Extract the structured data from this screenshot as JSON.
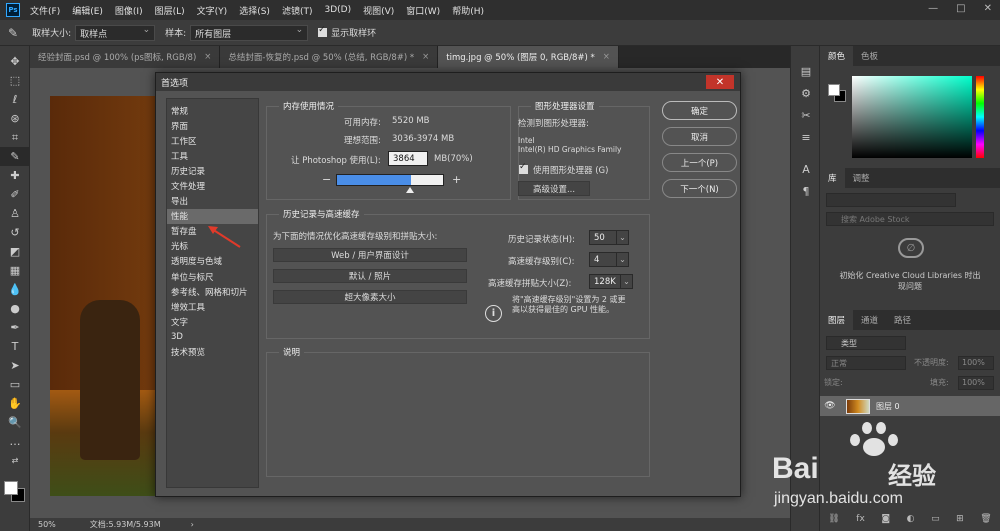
{
  "app": {
    "logo": "Ps",
    "menus": [
      "文件(F)",
      "编辑(E)",
      "图像(I)",
      "图层(L)",
      "文字(Y)",
      "选择(S)",
      "滤镜(T)",
      "3D(D)",
      "视图(V)",
      "窗口(W)",
      "帮助(H)"
    ],
    "window_controls": [
      "—",
      "□",
      "✕"
    ]
  },
  "options_bar": {
    "sample_size_label": "取样大小:",
    "sample_size_value": "取样点",
    "sample_label": "样本:",
    "sample_value": "所有图层",
    "show_ring_label": "显示取样环"
  },
  "tabs": [
    {
      "title": "经验封面.psd @ 100% (ps图标, RGB/8)",
      "close": "×"
    },
    {
      "title": "总结封面-恢复的.psd @ 50% (总结, RGB/8#) *",
      "close": "×"
    },
    {
      "title": "timg.jpg @ 50% (图层 0, RGB/8#) *",
      "close": "×"
    }
  ],
  "status_bar": {
    "zoom": "50%",
    "doc": "文档:5.93M/5.93M",
    "arrow": "›"
  },
  "dialog": {
    "title": "首选项",
    "close": "✕",
    "categories": [
      "常规",
      "界面",
      "工作区",
      "工具",
      "历史记录",
      "文件处理",
      "导出",
      "性能",
      "暂存盘",
      "光标",
      "透明度与色域",
      "单位与标尺",
      "参考线、网格和切片",
      "增效工具",
      "文字",
      "3D",
      "技术预览"
    ],
    "selected_category": "性能",
    "memory": {
      "title": "内存使用情况",
      "available_label": "可用内存:",
      "available_value": "5520 MB",
      "ideal_label": "理想范围:",
      "ideal_value": "3036-3974 MB",
      "use_label": "让 Photoshop 使用(L):",
      "use_value": "3864",
      "use_unit": "MB(70%)",
      "minus": "−",
      "plus": "+",
      "slider_fraction": 0.7
    },
    "gpu": {
      "title": "图形处理器设置",
      "detected_label": "检测到图形处理器:",
      "vendor": "Intel",
      "model": "Intel(R) HD Graphics Family",
      "use_gpu_label": "使用图形处理器 (G)",
      "advanced_button": "高级设置..."
    },
    "history_cache": {
      "title": "历史记录与高速缓存",
      "optimize_label": "为下面的情况优化高速缓存级别和拼贴大小:",
      "presets": [
        "Web / 用户界面设计",
        "默认 / 照片",
        "超大像素大小"
      ],
      "history_states_label": "历史记录状态(H):",
      "history_states_value": "50",
      "cache_levels_label": "高速缓存级别(C):",
      "cache_levels_value": "4",
      "tile_size_label": "高速缓存拼贴大小(Z):",
      "tile_size_value": "128K",
      "info_text_1": "将\"高速缓存级别\"设置为 2 或更",
      "info_text_2": "高以获得最佳的 GPU 性能。"
    },
    "description": {
      "title": "说明"
    },
    "buttons": {
      "ok": "确定",
      "cancel": "取消",
      "prev": "上一个(P)",
      "next": "下一个(N)"
    }
  },
  "right_panels": {
    "color_tabs": [
      "颜色",
      "色板"
    ],
    "library_tabs": [
      "库",
      "调整"
    ],
    "library_search_placeholder": "搜索 Adobe Stock",
    "library_message_1": "初始化 Creative Cloud Libraries 时出",
    "library_message_2": "现问题",
    "layer_tabs": [
      "图层",
      "通道",
      "路径"
    ],
    "layer_filter": "类型",
    "blend_mode": "正常",
    "opacity_label": "不透明度:",
    "opacity_value": "100%",
    "lock_label": "锁定:",
    "fill_label": "填充:",
    "fill_value": "100%",
    "layer_name": "图层 0"
  },
  "watermark": {
    "brand": "Bai",
    "brand2": "经验",
    "url": "jingyan.baidu.com"
  },
  "colors": {
    "accent_slider": "#4a8ee8",
    "close_red": "#c2342a",
    "annotation_arrow": "#e03a2a"
  }
}
